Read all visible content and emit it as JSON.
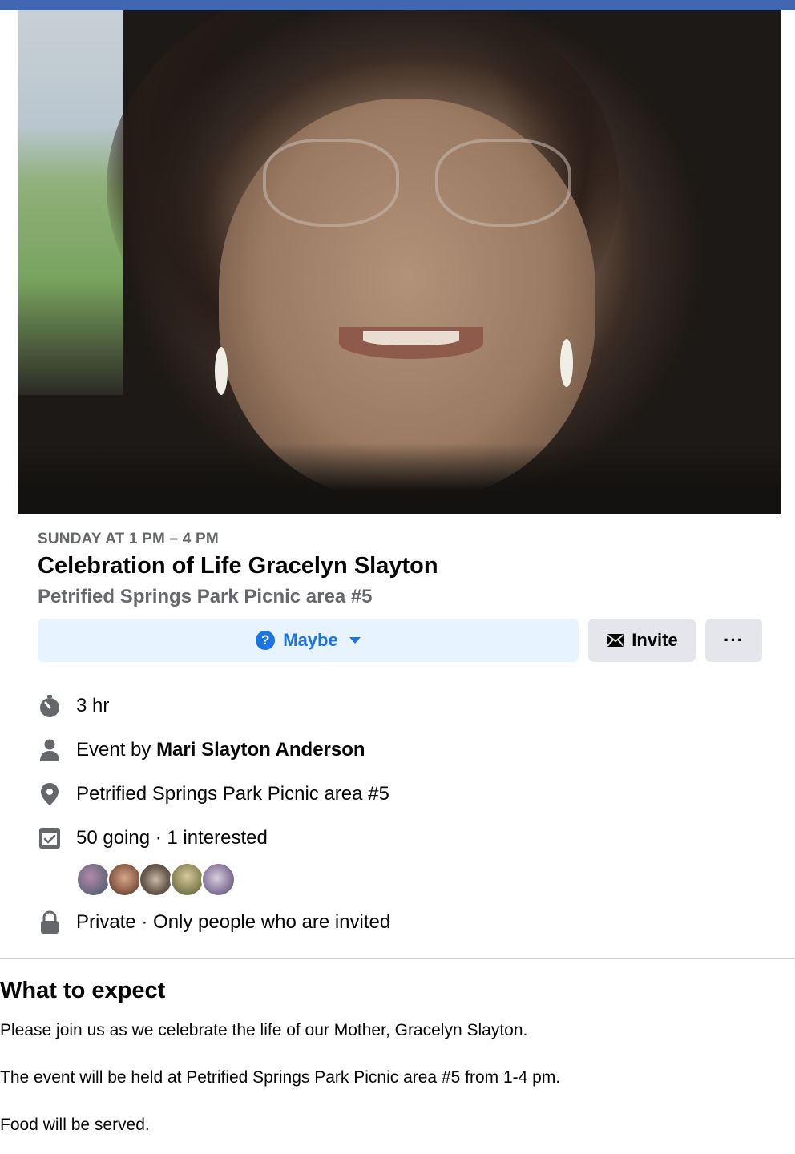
{
  "event": {
    "date_line": "SUNDAY AT 1 PM – 4 PM",
    "title": "Celebration of Life Gracelyn Slayton",
    "location_subtitle": "Petrified Springs Park Picnic area #5"
  },
  "actions": {
    "maybe_label": "Maybe",
    "invite_label": "Invite",
    "more_label": "···"
  },
  "details": {
    "duration": "3 hr",
    "event_by_prefix": "Event by ",
    "host": "Mari Slayton Anderson",
    "location": "Petrified Springs Park Picnic area #5",
    "attendance": "50 going · 1 interested",
    "privacy": "Private · Only people who are invited"
  },
  "about": {
    "heading": "What to expect",
    "paragraphs": [
      "Please join us as we celebrate the life of our Mother, Gracelyn Slayton.",
      "The event will be held at Petrified Springs Park Picnic area #5 from 1-4 pm.",
      "Food will be served."
    ]
  },
  "colors": {
    "accent": "#1b74e4",
    "top_bar": "#4267b2",
    "secondary_text": "#65676b",
    "icon": "#65676b"
  },
  "icons": [
    "stopwatch-icon",
    "person-icon",
    "location-pin-icon",
    "calendar-check-icon",
    "lock-icon",
    "envelope-icon",
    "question-icon",
    "caret-down-icon"
  ]
}
